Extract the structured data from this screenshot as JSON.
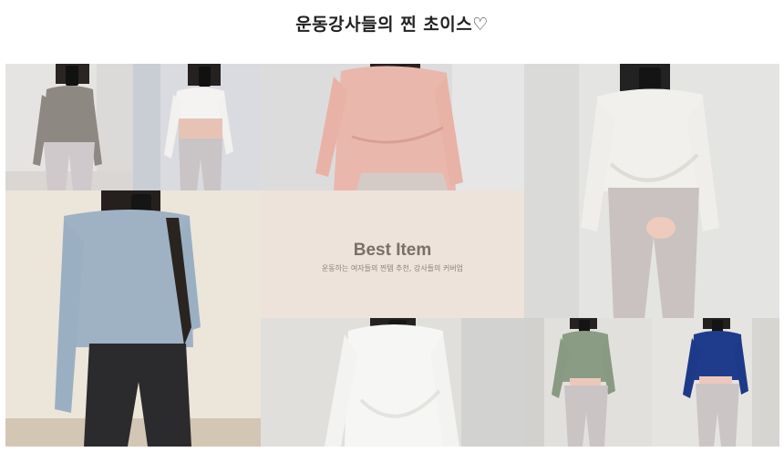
{
  "page": {
    "title": "운동강사들의 찐 초이스♡"
  },
  "banner": {
    "title": "Best Item",
    "subtitle": "운동하는 여자들의 찐템 추천, 강사들의 커버업"
  },
  "products": [
    {
      "name": "grey-top-photo",
      "color": "#8e8883"
    },
    {
      "name": "white-top-photo",
      "color": "#f2f1ef"
    },
    {
      "name": "pink-top-photo",
      "color": "#eab7ad"
    },
    {
      "name": "ivory-wrap-top-photo",
      "color": "#f1f0ec"
    },
    {
      "name": "blue-top-photo",
      "color": "#9eb2c4"
    },
    {
      "name": "white-wrap-top-photo",
      "color": "#f6f6f4"
    },
    {
      "name": "sage-top-photo",
      "color": "#8b9c85"
    },
    {
      "name": "navy-top-photo",
      "color": "#1f3c8c"
    }
  ]
}
